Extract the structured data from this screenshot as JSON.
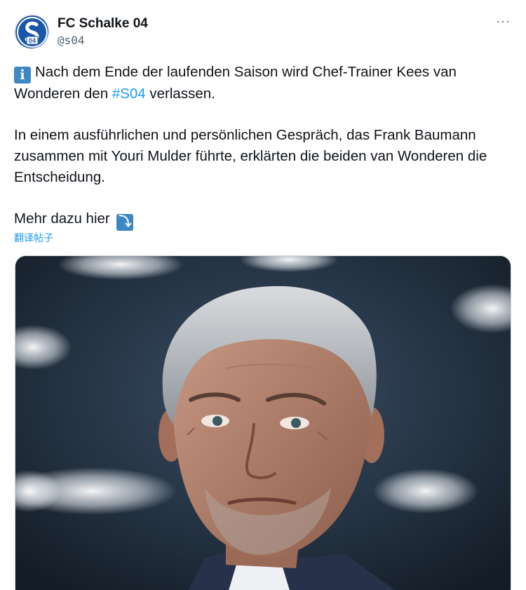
{
  "account": {
    "display_name": "FC Schalke 04",
    "handle": "@s04",
    "avatar_icon": "schalke-crest-icon",
    "crest_text": "04",
    "crest_color": "#1b57a8"
  },
  "menu": {
    "more_icon": "more-horizontal-icon",
    "more_glyph": "···"
  },
  "post": {
    "info_emoji": "i",
    "line1_before": "Nach dem Ende der laufenden Saison wird Chef-Trainer Kees van Wonderen den ",
    "hashtag": "#S04",
    "line1_after": " verlassen.",
    "paragraph2": "In einem ausführlichen und persönlichen Gespräch, das Frank Baumann zusammen mit Youri Mulder führte, erklärten die beiden van Wonderen die Entscheidung.",
    "paragraph3": "Mehr dazu hier ",
    "arrow_emoji": "⤵"
  },
  "translate_label": "翻译帖子",
  "media": {
    "icon": "photo-coach-portrait",
    "background_color": "#1f2c3a"
  },
  "colors": {
    "link": "#1d9bf0",
    "text": "#0f1419",
    "secondary": "#536471"
  }
}
